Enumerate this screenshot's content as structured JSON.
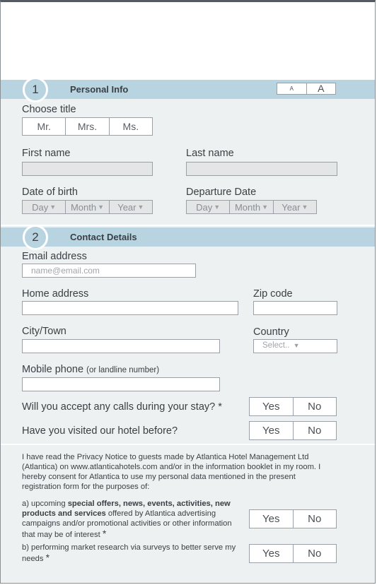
{
  "font_toggle": {
    "small": "A",
    "large": "A"
  },
  "section1": {
    "number": "1",
    "title": "Personal Info"
  },
  "title_choice": {
    "label": "Choose title",
    "options": [
      "Mr.",
      "Mrs.",
      "Ms."
    ]
  },
  "first_name": {
    "label": "First name"
  },
  "last_name": {
    "label": "Last name"
  },
  "dob": {
    "label": "Date of birth",
    "day": "Day",
    "month": "Month",
    "year": "Year"
  },
  "departure": {
    "label": "Departure Date",
    "day": "Day",
    "month": "Month",
    "year": "Year"
  },
  "section2": {
    "number": "2",
    "title": "Contact Details"
  },
  "email": {
    "label": "Email address",
    "placeholder": "name@email.com"
  },
  "home_address": {
    "label": "Home address"
  },
  "zip": {
    "label": "Zip code"
  },
  "city": {
    "label": "City/Town"
  },
  "country": {
    "label": "Country",
    "placeholder": "Select.."
  },
  "mobile": {
    "label": "Mobile phone",
    "note": "(or landline number)"
  },
  "q_calls": {
    "label": "Will you accept any calls during your stay? *",
    "yes": "Yes",
    "no": "No"
  },
  "q_visited": {
    "label": "Have you visited our hotel before?",
    "yes": "Yes",
    "no": "No"
  },
  "privacy": {
    "intro_line1": "I have read the Privacy Notice to guests made by Atlantica Hotel Management Ltd",
    "intro_line2": "(Atlantica) on www.atlanticahotels.com and/or in the information booklet in my room. I",
    "intro_line3": "hereby consent for Atlantica to use my personal data mentioned in the present",
    "intro_line4": "registration form for the purposes of:",
    "a_prefix": "a) upcoming ",
    "a_bold": "special offers, news, events, activities, new products and services",
    "a_suffix": " offered by Atlantica advertising campaigns and/or promotional activities or other information that may be of interest",
    "a_star": "*",
    "a_yes": "Yes",
    "a_no": "No",
    "b_text": "b) performing market research via surveys to better serve my needs",
    "b_star": "*",
    "b_yes": "Yes",
    "b_no": "No"
  }
}
